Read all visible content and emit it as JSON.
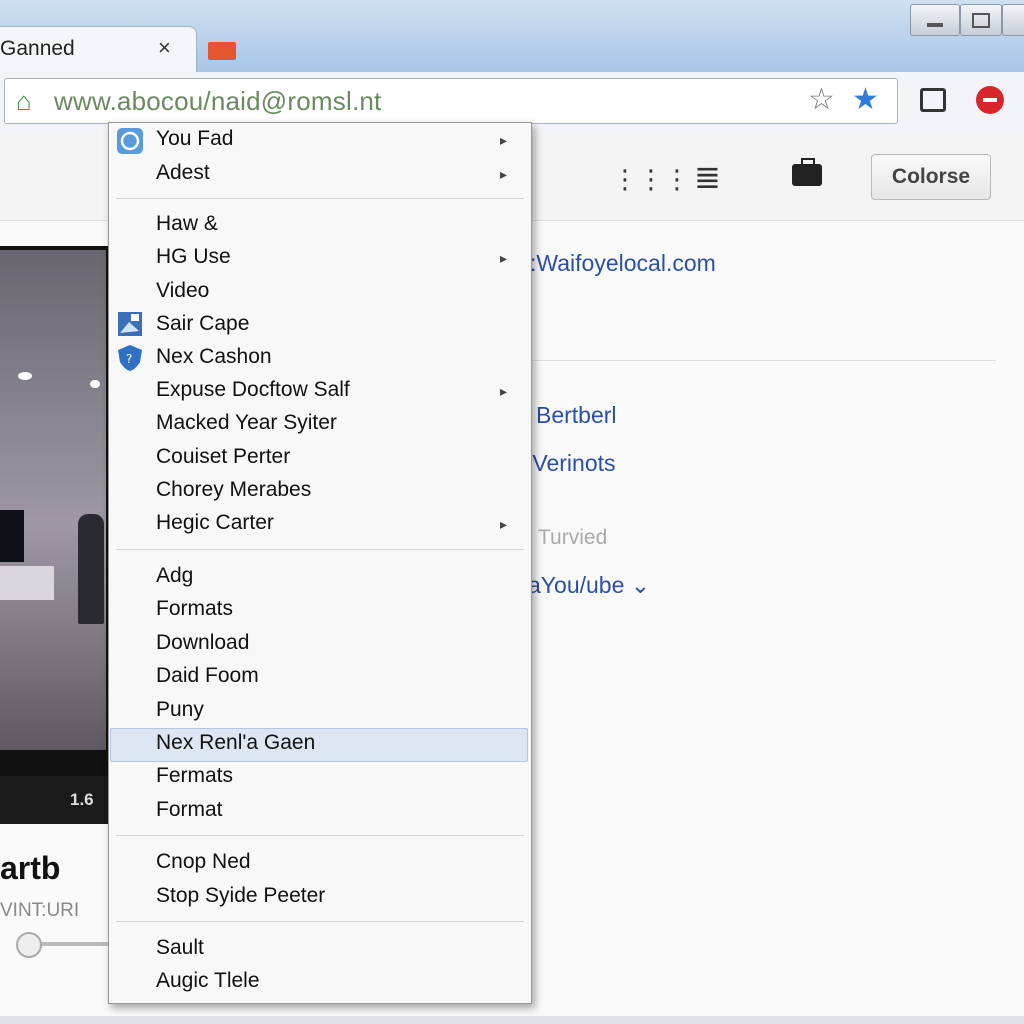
{
  "tab": {
    "title": "Ganned",
    "close": "×"
  },
  "address_bar": {
    "url": "www.abocou/naid@romsl.nt"
  },
  "page_header": {
    "button_label": "Colorse"
  },
  "video": {
    "time": "1.6",
    "title": "artb",
    "subtitle": "VINT:URI"
  },
  "side_panel": {
    "site_link": ":Waifoyelocal.com",
    "link_1": "Bertberl",
    "link_2": ":Verinots",
    "muted_label": "Turvied",
    "youtube_link": "aYou/ube ⌄"
  },
  "context_menu": {
    "items": [
      {
        "label": "You Fad",
        "icon": "globe-icon",
        "has_submenu": true
      },
      {
        "label": "Adest",
        "has_submenu": true
      },
      {
        "label": "Haw &"
      },
      {
        "label": "HG Use",
        "has_submenu": true
      },
      {
        "label": "Video"
      },
      {
        "label": "Sair Cape",
        "icon": "image-icon"
      },
      {
        "label": "Nex Cashon",
        "icon": "shield-icon"
      },
      {
        "label": "Expuse Docftow Salf",
        "has_submenu": true
      },
      {
        "label": "Macked Year Syiter"
      },
      {
        "label": "Couiset Perter"
      },
      {
        "label": "Chorey Merabes"
      },
      {
        "label": "Hegic Carter",
        "has_submenu": true
      },
      {
        "label": "Adg"
      },
      {
        "label": "Formats"
      },
      {
        "label": "Download"
      },
      {
        "label": "Daid Foom"
      },
      {
        "label": "Puny"
      },
      {
        "label": "Nex Renl'a Gaen",
        "highlighted": true
      },
      {
        "label": "Fermats"
      },
      {
        "label": "Format"
      },
      {
        "label": "Cnop Ned"
      },
      {
        "label": "Stop Syide Peeter"
      },
      {
        "label": "Sault"
      },
      {
        "label": "Augic Tlele"
      }
    ]
  },
  "colors": {
    "accent": "#2f7ed8",
    "link": "#2b4fa8",
    "stop": "#d9262a",
    "highlight": "#dde6f2"
  }
}
